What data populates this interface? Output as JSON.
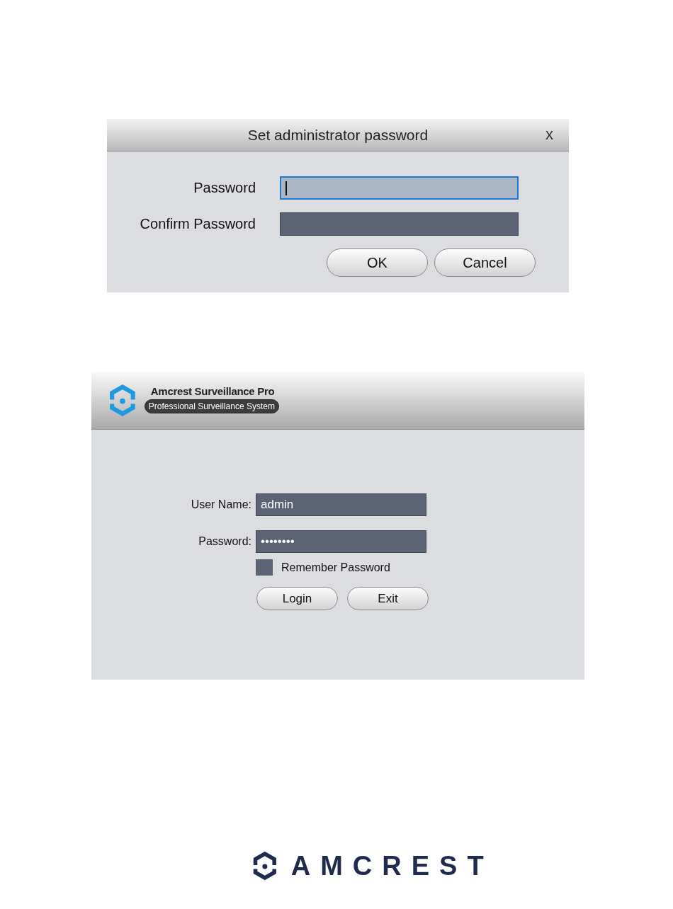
{
  "set_password_dialog": {
    "title": "Set administrator password",
    "close": "x",
    "fields": [
      {
        "label": "Password",
        "focused": true
      },
      {
        "label": "Confirm Password",
        "focused": false
      }
    ],
    "buttons": [
      "OK",
      "Cancel"
    ]
  },
  "login_window": {
    "app_title": "Amcrest Surveillance Pro",
    "app_subtitle": "Professional Surveillance System",
    "fields": [
      {
        "label": "User Name:",
        "value": "admin"
      },
      {
        "label": "Password:",
        "value": "••••••••"
      }
    ],
    "remember": {
      "label": "Remember Password",
      "checked": false
    },
    "buttons": [
      "Login",
      "Exit"
    ]
  },
  "footer_logo": {
    "wordmark": "AMCREST"
  }
}
